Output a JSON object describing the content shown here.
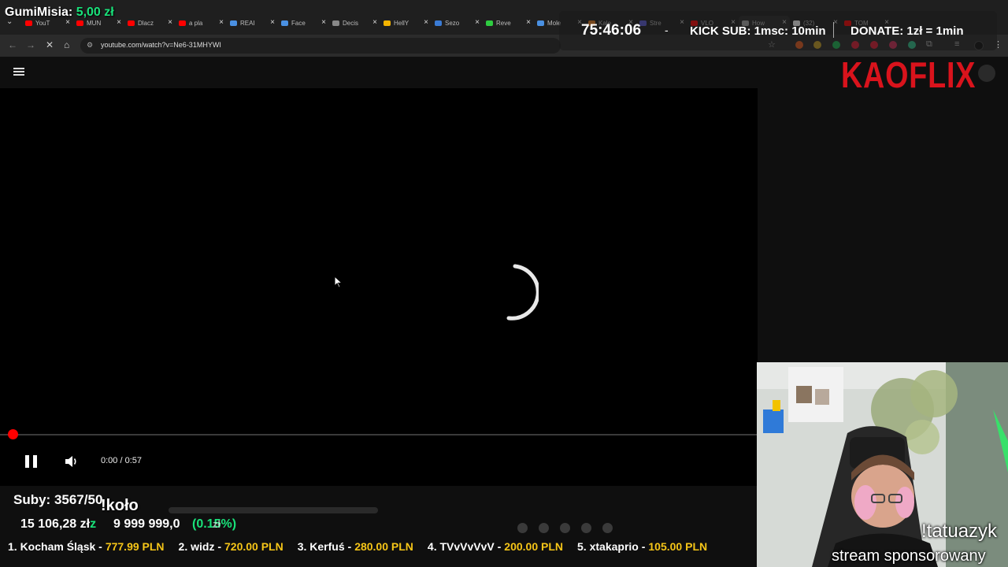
{
  "overlay": {
    "donor_name": "GumiMisia:",
    "donor_amount": "5,00 zł",
    "timer": "75:46:06",
    "timer_dash": "-",
    "kick_sub": "KICK SUB: 1msc: 10min",
    "donate": "DONATE: 1zł = 1min",
    "logo": "KAOFLIX",
    "subs": "Suby: 3567/50",
    "koło": "!koło",
    "money_value": "15 106,28 zł",
    "money_suffix": "z",
    "goal_total": "9 999 999,0",
    "goal_percent": "(0.15%)",
    "goal_overlap": "zł",
    "webcam_command": "!tatuazyk",
    "webcam_caption": "stream sponsorowany"
  },
  "ticker": [
    {
      "name": "1. Kocham Śląsk -",
      "amount": "777.99 PLN"
    },
    {
      "name": "2. widz -",
      "amount": "720.00 PLN"
    },
    {
      "name": "3. Kerfuś -",
      "amount": "280.00 PLN"
    },
    {
      "name": "4. TVvVvVvV -",
      "amount": "200.00 PLN"
    },
    {
      "name": "5. xtakaprio -",
      "amount": "105.00 PLN"
    }
  ],
  "browser": {
    "url": "youtube.com/watch?v=Ne6-31MHYWI",
    "tabs": [
      {
        "label": "YouT",
        "color": "#ff0000"
      },
      {
        "label": "MUN",
        "color": "#ff0000"
      },
      {
        "label": "Dlacz",
        "color": "#ff0000"
      },
      {
        "label": "a pla",
        "color": "#ff0000"
      },
      {
        "label": "REAI",
        "color": "#4a90e2"
      },
      {
        "label": "Face",
        "color": "#4a90e2"
      },
      {
        "label": "Decis",
        "color": "#888888"
      },
      {
        "label": "HellY",
        "color": "#f4b400"
      },
      {
        "label": "Sezo",
        "color": "#3a7bd5"
      },
      {
        "label": "Reve",
        "color": "#2ecc40"
      },
      {
        "label": "Mole",
        "color": "#4a90e2"
      },
      {
        "label": "Kale",
        "color": "#e67e22"
      },
      {
        "label": "Stre",
        "color": "#5b5bd6"
      },
      {
        "label": "VLO",
        "color": "#ff0000"
      },
      {
        "label": "How",
        "color": "#aaaaaa"
      },
      {
        "label": "(32)",
        "color": "#ffffff"
      },
      {
        "label": "TOM",
        "color": "#ff0000"
      }
    ]
  },
  "player": {
    "time": "0:00 / 0:57",
    "progress": 0.0
  },
  "colors": {
    "accent_green": "#19e27a",
    "logo_red": "#d9131c",
    "ticker_amount": "#f5c518",
    "progress_red": "#ff0000"
  }
}
